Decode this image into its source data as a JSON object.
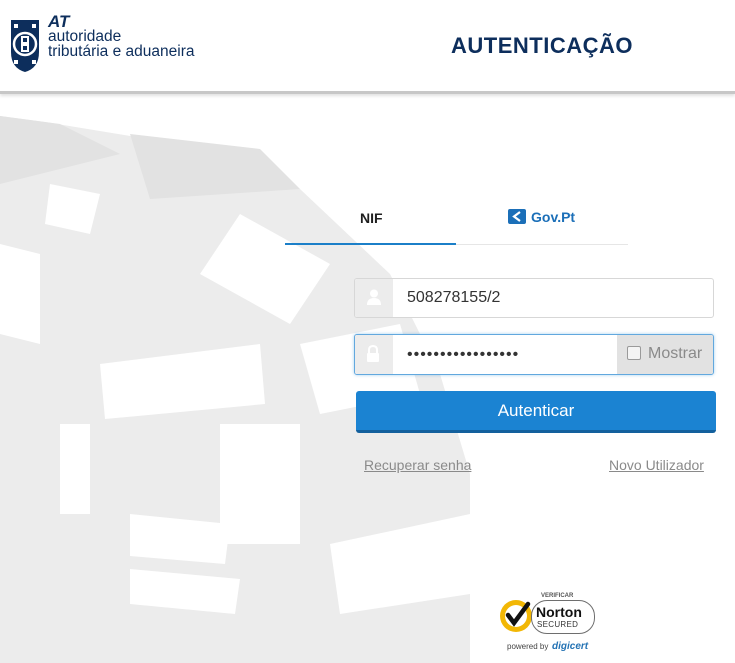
{
  "header": {
    "logo": {
      "at": "AT",
      "line1": "autoridade",
      "line2": "tributária e aduaneira"
    },
    "title": "AUTENTICAÇÃO"
  },
  "tabs": [
    {
      "label": "NIF",
      "active": true
    },
    {
      "label": "Gov.Pt",
      "icon": "gov-pt-icon",
      "active": false
    }
  ],
  "form": {
    "username": {
      "value": "508278155/2",
      "icon": "user-icon"
    },
    "password": {
      "value": "•••••••••••••••••",
      "icon": "lock-icon",
      "show_label": "Mostrar",
      "show_checked": false
    },
    "submit_label": "Autenticar",
    "recover_label": "Recuperar senha",
    "new_user_label": "Novo Utilizador"
  },
  "badge": {
    "verify": "VERIFICAR",
    "name": "Norton",
    "secured": "SECURED",
    "powered": "powered by",
    "brand": "digicert"
  },
  "colors": {
    "navy": "#0d2e5c",
    "accent": "#1b83d2",
    "seal": "#e6e6e6"
  }
}
